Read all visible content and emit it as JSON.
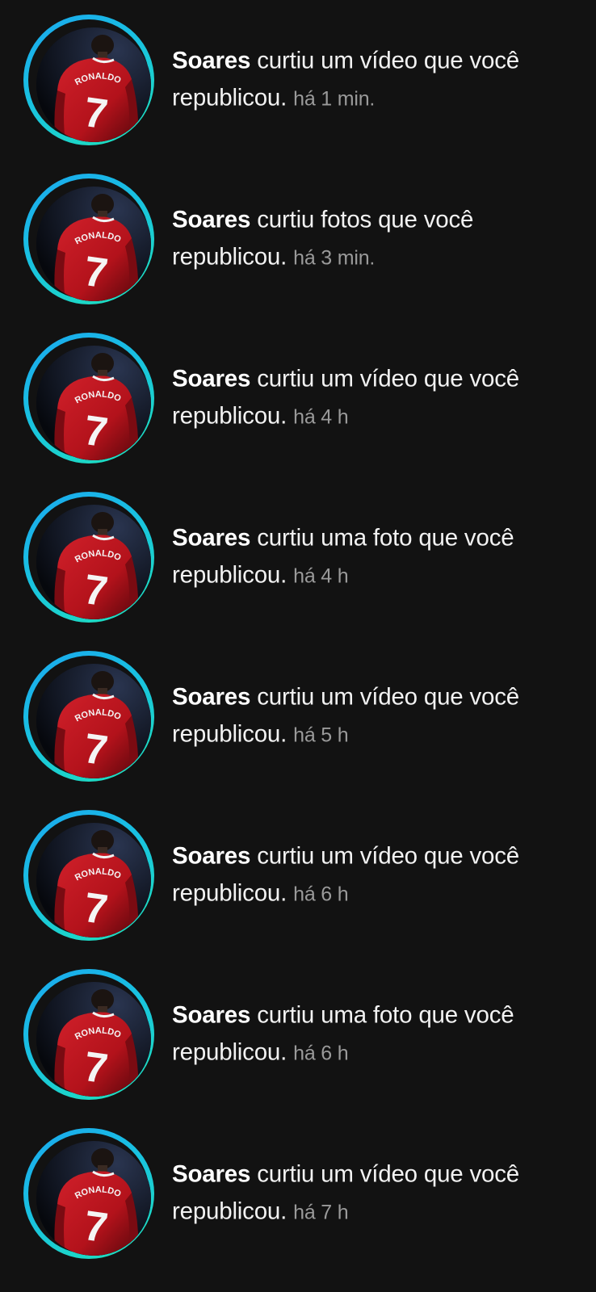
{
  "theme": {
    "background": "#121212",
    "text": "#f2f2f2",
    "muted": "#9a9a9a",
    "ring_start": "#1aa7f0",
    "ring_end": "#1fe3b8",
    "jersey": "#b3121b"
  },
  "notifications": [
    {
      "user": "Soares",
      "action": "curtiu um vídeo que você",
      "action_end": "republicou.",
      "time": "há 1 min.",
      "avatar_icon": "ronaldo-jersey-7-avatar"
    },
    {
      "user": "Soares",
      "action": "curtiu fotos que você",
      "action_end": "republicou.",
      "time": "há 3 min.",
      "avatar_icon": "ronaldo-jersey-7-avatar"
    },
    {
      "user": "Soares",
      "action": "curtiu um vídeo que você",
      "action_end": "republicou.",
      "time": "há 4 h",
      "avatar_icon": "ronaldo-jersey-7-avatar"
    },
    {
      "user": "Soares",
      "action": "curtiu uma foto que você",
      "action_end": "republicou.",
      "time": "há 4 h",
      "avatar_icon": "ronaldo-jersey-7-avatar"
    },
    {
      "user": "Soares",
      "action": "curtiu um vídeo que você",
      "action_end": "republicou.",
      "time": "há 5 h",
      "avatar_icon": "ronaldo-jersey-7-avatar"
    },
    {
      "user": "Soares",
      "action": "curtiu um vídeo que você",
      "action_end": "republicou.",
      "time": "há 6 h",
      "avatar_icon": "ronaldo-jersey-7-avatar"
    },
    {
      "user": "Soares",
      "action": "curtiu uma foto que você",
      "action_end": "republicou.",
      "time": "há 6 h",
      "avatar_icon": "ronaldo-jersey-7-avatar"
    },
    {
      "user": "Soares",
      "action": "curtiu um vídeo que você",
      "action_end": "republicou.",
      "time": "há 7 h",
      "avatar_icon": "ronaldo-jersey-7-avatar"
    }
  ]
}
